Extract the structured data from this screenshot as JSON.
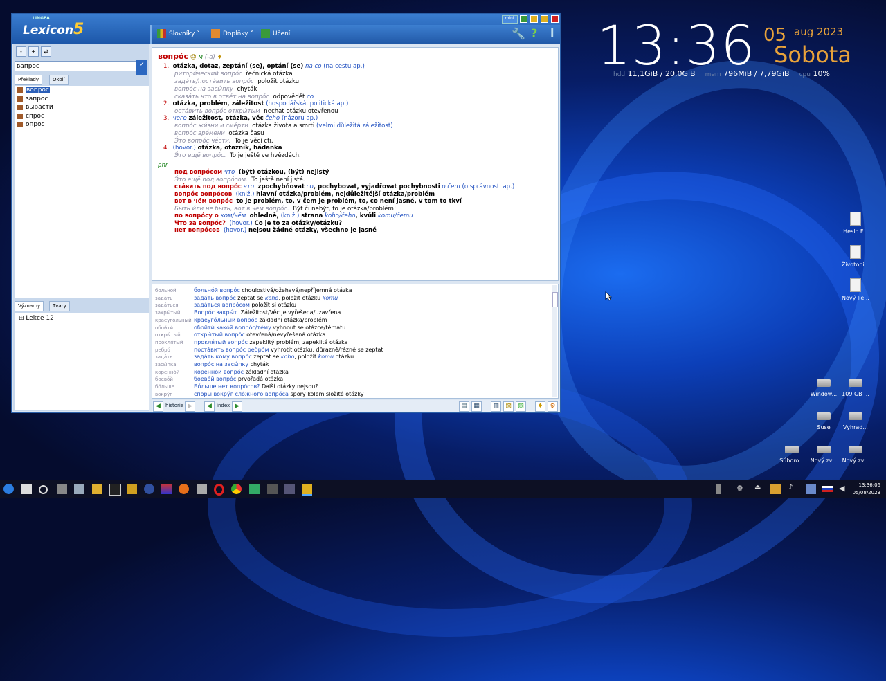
{
  "clock": {
    "time": "13:36",
    "day": "05",
    "month_year": "aug 2023",
    "weekday": "Sobota"
  },
  "stats": {
    "hdd_label": "hdd",
    "hdd_value": "11,1GiB / 20,0GiB",
    "mem_label": "mem",
    "mem_value": "796MiB / 7,79GiB",
    "cpu_label": "cpu",
    "cpu_value": "10%"
  },
  "desktop_icons": {
    "heslo": "Heslo F...",
    "zivotopis": "Životopi...",
    "novy_lie": "Nový lie...",
    "windows": "Window...",
    "disk109": "109 GB ...",
    "suse": "Suse",
    "vyhrad": "Vyhrad...",
    "suboro": "Súboro...",
    "novy_zv1": "Nový zv...",
    "novy_zv2": "Nový zv..."
  },
  "window": {
    "logo_brand": "LINGEA",
    "logo_text": "Lexicon",
    "logo_num": "5",
    "mini_label": "mini",
    "menu": {
      "slovniky": "Slovníky",
      "doplnky": "Doplňky",
      "uceni": "Učení"
    },
    "search_value": "вапрос",
    "tabs": {
      "preklady": "Překlady",
      "okoli": "Okolí",
      "vyznamy": "Významy",
      "tvary": "Tvary"
    },
    "wordlist": [
      "вопрос",
      "запрос",
      "вырасти",
      "спрос",
      "опрос"
    ],
    "lekce": "Lekce 12",
    "bottom": {
      "historie": "historie",
      "index": "index"
    }
  },
  "entry": {
    "headword": "вопро́с",
    "gram": "м",
    "gram2": "(-а)",
    "s1_num": "1.",
    "s1": "otázka, dotaz, zeptání (se), optání (se)",
    "s1_note": "na co",
    "s1_note2": "(na cestu ap.)",
    "s1_e1_ru": "ритори́ческий вопро́с",
    "s1_e1_cz": "řečnická otázka",
    "s1_e2_ru": "зада́ть/поста́вить вопро́с",
    "s1_e2_cz": "položit otázku",
    "s1_e3_ru": "вопро́с на засы́пку",
    "s1_e3_cz": "chyták",
    "s1_e4_ru": "сказа́ть что в отве́т на вопро́с",
    "s1_e4_cz": "odpovědět",
    "s1_e4_co": "co",
    "s2_num": "2.",
    "s2": "otázka, problém, záležitost",
    "s2_note": "(hospodářská, politická ap.)",
    "s2_e1_ru": "оста́вить вопро́с откры́тым",
    "s2_e1_cz": "nechat otázku otevřenou",
    "s3_num": "3.",
    "s3_pre": "чего",
    "s3": "záležitost, otázka, věc",
    "s3_ceho": "čeho",
    "s3_note": "(názoru ap.)",
    "s3_e1_ru": "вопро́с жи́зни и сме́рти",
    "s3_e1_cz": "otázka života a smrti",
    "s3_e1_note": "(velmi důležitá záležitost)",
    "s3_e2_ru": "вопро́с вре́мени",
    "s3_e2_cz": "otázka času",
    "s3_e3_ru": "Э́то вопро́с че́сти.",
    "s3_e3_cz": "To je věcí cti.",
    "s4_num": "4.",
    "s4_note": "(hovor.)",
    "s4": "otázka, otazník, hádanka",
    "s4_e1_ru": "Э́то ещё вопро́с.",
    "s4_e1_cz": "To je ještě ve hvězdách.",
    "phr": "phr",
    "p1_ru": "под вопро́сом",
    "p1_what": "что",
    "p1_cz": "(být) otázkou, (být) nejistý",
    "p1_e_ru": "Э́то ещё под вопро́сом.",
    "p1_e_cz": "To ještě není jisté.",
    "p2_ru": "ста́вить под вопро́с",
    "p2_what": "что",
    "p2_cz": "zpochybňovat",
    "p2_co": "co",
    "p2_cz2": ", pochybovat, vyjadřovat pochybnosti",
    "p2_ocem": "o čem",
    "p2_note": "(o správnosti ap.)",
    "p3_ru": "вопро́с вопро́сов",
    "p3_note": "(kniž.)",
    "p3_cz": "hlavní otázka/problém, nejdůležitější otázka/problém",
    "p4_ru": "вот в чём вопро́с",
    "p4_cz": "to je problém, to, v čem je problém, to, co není jasné, v tom to tkví",
    "p4_e_ru": "Быть и́ли не быть, вот в чём вопро́с.",
    "p4_e_cz": "Být či nebýt, to je otázka/problém!",
    "p5_ru": "по вопро́су о",
    "p5_what": "ком/чём",
    "p5_cz": "ohledně,",
    "p5_note": "(kniž.)",
    "p5_cz2": "strana",
    "p5_koho": "koho/čeho",
    "p5_cz3": ", kvůli",
    "p5_komu": "komu/čemu",
    "p6_ru": "Что за вопро́с?",
    "p6_note": "(hovor.)",
    "p6_cz": "Co je to za otázky/otázku?",
    "p7_ru": "нет вопро́сов",
    "p7_note": "(hovor.)",
    "p7_cz": "nejsou žádné otázky, všechno je jasné"
  },
  "examples": [
    {
      "k": "больно́й",
      "a": "больно́й вопро́с",
      "b": "choulostivá/ožehavá/nepříjemná otázka"
    },
    {
      "k": "зада́ть",
      "a": "зада́ть вопро́с",
      "b": "zeptat se",
      "c": "koho",
      "d": ", položit otázku",
      "e": "komu"
    },
    {
      "k": "зада́ться",
      "a": "зада́ться вопро́сом",
      "b": "položit si otázku"
    },
    {
      "k": "закры́тый",
      "a": "Вопро́с закры́т.",
      "b": "Záležitost/Věc je vyřešena/uzavřena."
    },
    {
      "k": "краеуго́льный",
      "a": "краеуго́льный вопро́с",
      "b": "základní otázka/problém"
    },
    {
      "k": "обойти́",
      "a": "обойти́ како́й вопро́с/те́му",
      "b": "vyhnout se otázce/tématu"
    },
    {
      "k": "откры́тый",
      "a": "откры́тый вопро́с",
      "b": "otevřená/nevyřešená otázka"
    },
    {
      "k": "прокля́тый",
      "a": "прокля́тый вопро́с",
      "b": "zapeklitý problém, zapeklitá otázka"
    },
    {
      "k": "ребро́",
      "a": "поста́вить вопро́с ребро́м",
      "b": "vyhrotit otázku, důrazně/rázně se zeptat"
    },
    {
      "k": "зада́ть",
      "a": "зада́ть кому вопро́с",
      "b": "zeptat se",
      "c": "koho",
      "d": ", položit",
      "e": "komu",
      "f": "otázku"
    },
    {
      "k": "засы́пка",
      "a": "вопро́с на засы́пку",
      "b": "chyták"
    },
    {
      "k": "коренно́й",
      "a": "коренно́й вопро́с",
      "b": "základní otázka"
    },
    {
      "k": "боево́й",
      "a": "боево́й вопро́с",
      "b": "prvořadá otázka"
    },
    {
      "k": "бо́льше",
      "a": "Бо́льше нет вопро́сов?",
      "b": "Další otázky nejsou?"
    },
    {
      "k": "вокру́г",
      "a": "споры вокру́г сло́жного вопро́са",
      "b": "spory kolem složité otázky"
    }
  ],
  "taskbar": {
    "time": "13:36:06",
    "date": "05/08/2023"
  }
}
